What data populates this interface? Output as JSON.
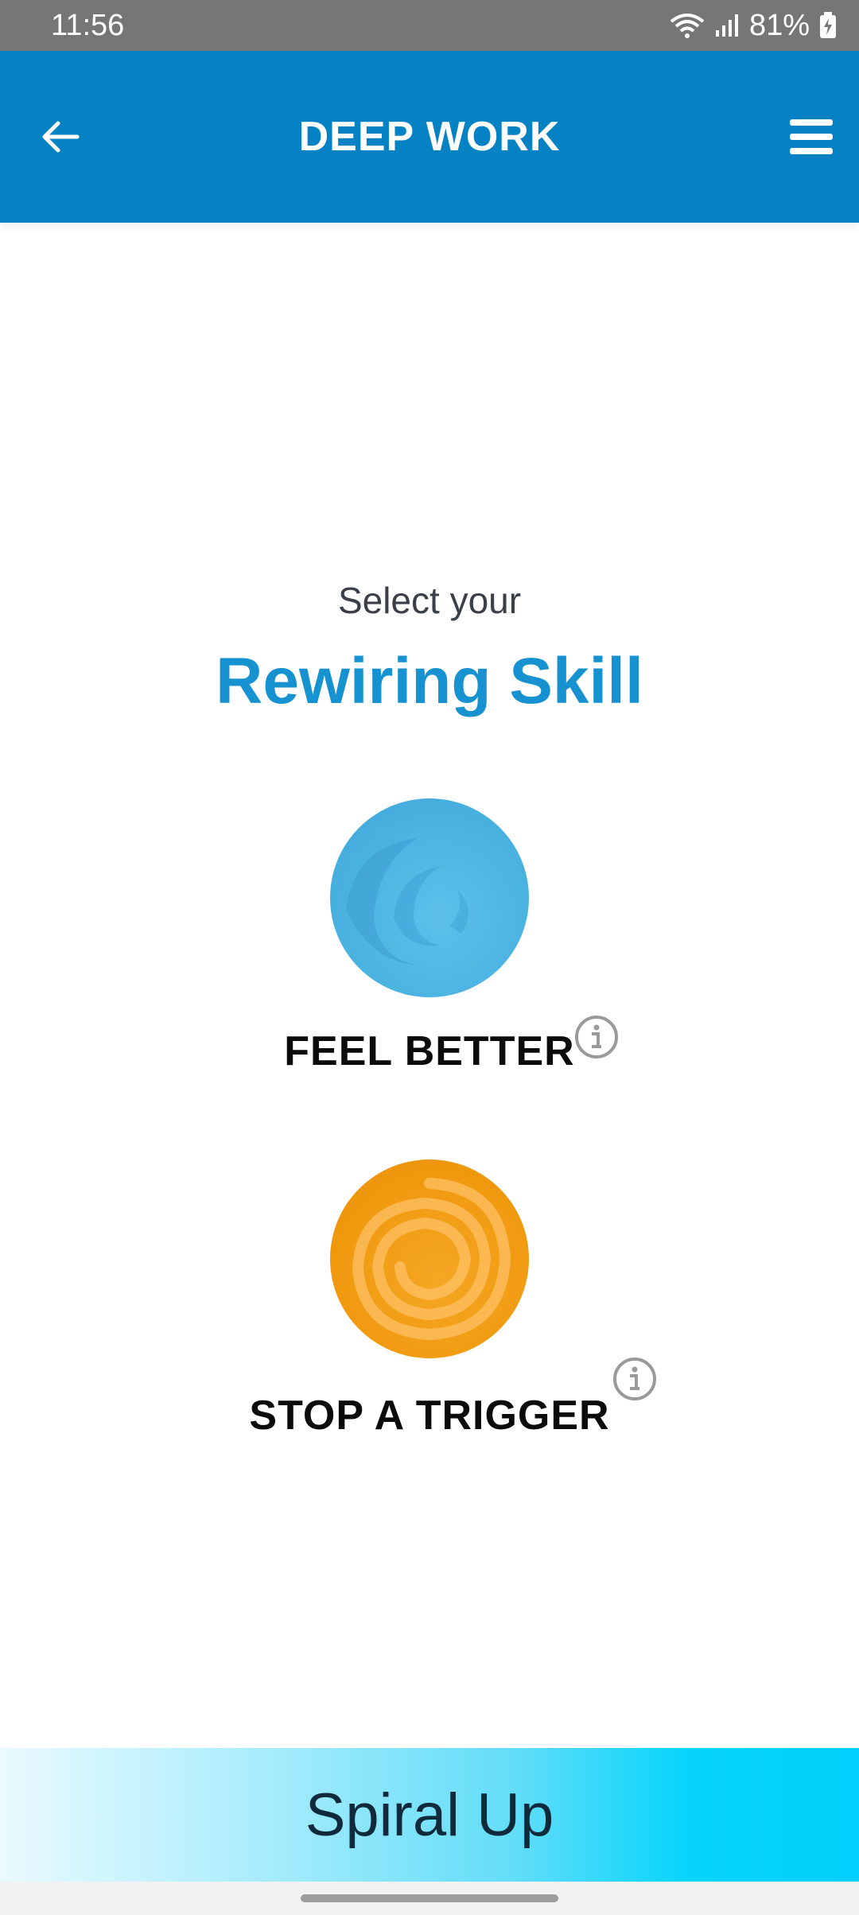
{
  "status_bar": {
    "time": "11:56",
    "battery": "81%",
    "icons": [
      "wifi-icon",
      "signal-icon",
      "battery-charging-icon"
    ]
  },
  "app_bar": {
    "title": "DEEP WORK",
    "back_icon": "back-arrow-icon",
    "menu_icon": "hamburger-menu-icon"
  },
  "main": {
    "prompt": "Select your",
    "heading": "Rewiring Skill",
    "skills": [
      {
        "label": "FEEL BETTER",
        "icon": "blue-spiral-orb",
        "color": "#4ab2e0"
      },
      {
        "label": "STOP A TRIGGER",
        "icon": "orange-spiral-orb",
        "color": "#f09a10"
      }
    ]
  },
  "bottom_bar": {
    "label": "Spiral Up"
  },
  "colors": {
    "app_bar": "#0582c4",
    "heading": "#1592cf",
    "status_bar": "#767676"
  }
}
